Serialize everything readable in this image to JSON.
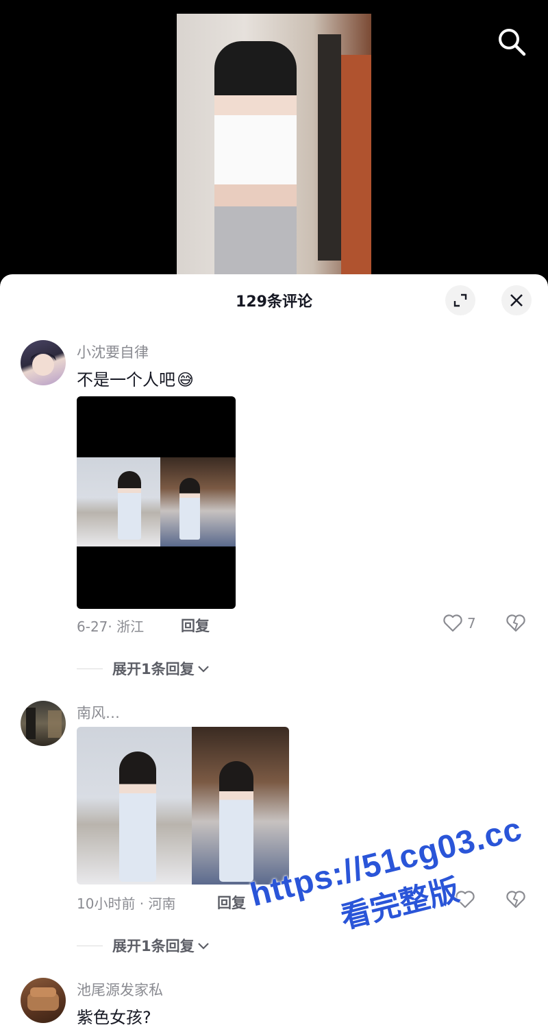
{
  "header": {
    "search_icon": "search-icon"
  },
  "sheet": {
    "title": "129条评论",
    "expand_icon": "expand-icon",
    "close_icon": "close-icon"
  },
  "comments": [
    {
      "username": "小沈要自律",
      "text": "不是一个人吧",
      "emoji": "😅",
      "meta": "6-27· 浙江",
      "reply_label": "回复",
      "likes": "7",
      "expand_label": "展开1条回复"
    },
    {
      "username": "南风…",
      "meta": "10小时前 · 河南",
      "reply_label": "回复",
      "expand_label": "展开1条回复"
    },
    {
      "username": "池尾源发家私",
      "text": "紫色女孩?"
    }
  ],
  "watermark": {
    "url": "https://51cg03.cc",
    "text": "看完整版"
  },
  "colors": {
    "accent": "#2a55d8",
    "text": "#161823",
    "muted": "#8a8b91"
  }
}
